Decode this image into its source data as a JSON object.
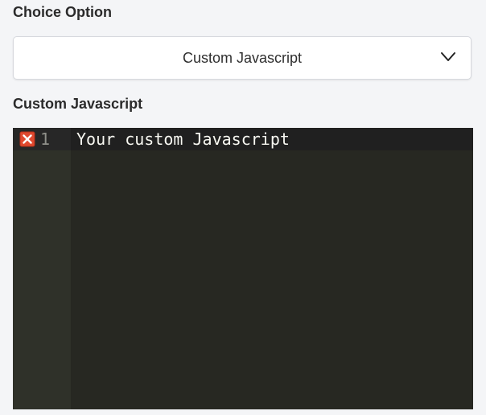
{
  "choice_option": {
    "label": "Choice Option",
    "selected_value": "Custom Javascript",
    "dropdown_icon": "chevron-down-icon"
  },
  "custom_javascript": {
    "label": "Custom Javascript",
    "editor": {
      "lines": [
        {
          "number": "1",
          "text": "Your custom Javascript",
          "annotation_icon": "error-icon"
        }
      ],
      "colors": {
        "background": "#272822",
        "gutter": "#2f3129",
        "text": "#f8f8f2",
        "line_number": "#8f908a",
        "error": "#e0492f"
      }
    }
  }
}
